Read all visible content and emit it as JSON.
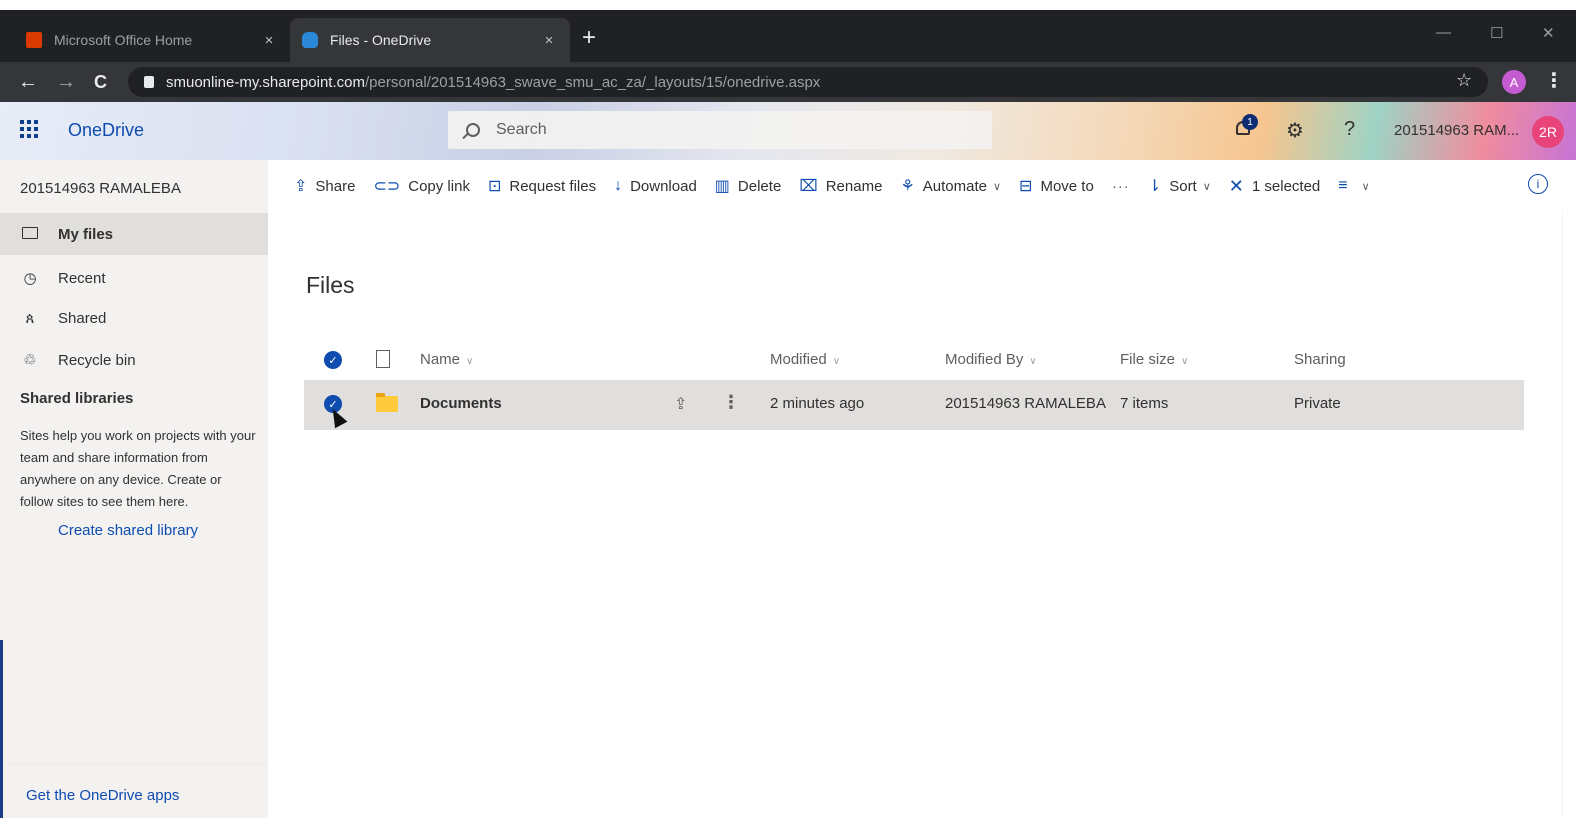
{
  "browser": {
    "tabs": [
      {
        "title": "Microsoft Office Home",
        "close": "×"
      },
      {
        "title": "Files - OneDrive",
        "close": "×"
      }
    ],
    "new_tab": "+",
    "window_controls": {
      "minimize": "—",
      "maximize": "☐",
      "close": "✕"
    },
    "nav": {
      "back": "←",
      "forward": "→",
      "reload": "C"
    },
    "url_host": "smuonline-my.sharepoint.com",
    "url_path": "/personal/201514963_swave_smu_ac_za/_layouts/15/onedrive.aspx",
    "star": "☆",
    "profile_initial": "A",
    "menu": "⋮"
  },
  "suite": {
    "app_name": "OneDrive",
    "search_placeholder": "Search",
    "notification_count": "1",
    "settings_icon": "⚙",
    "help_icon": "?",
    "user_name": "201514963 RAM...",
    "avatar_initials": "2R"
  },
  "sidebar": {
    "owner": "201514963 RAMALEBA",
    "items": [
      {
        "label": "My files",
        "icon": "folder-icon"
      },
      {
        "label": "Recent",
        "icon": "clock-icon"
      },
      {
        "label": "Shared",
        "icon": "people-icon"
      },
      {
        "label": "Recycle bin",
        "icon": "recycle-bin-icon"
      }
    ],
    "shared_libraries_title": "Shared libraries",
    "shared_libraries_desc": "Sites help you work on projects with your team and share information from anywhere on any device. Create or follow sites to see them here.",
    "create_library": "Create shared library",
    "get_apps": "Get the OneDrive apps"
  },
  "commands": {
    "share": "Share",
    "copy_link": "Copy link",
    "request_files": "Request files",
    "download": "Download",
    "delete": "Delete",
    "rename": "Rename",
    "automate": "Automate",
    "move_to": "Move to",
    "more": "···",
    "sort": "Sort",
    "selected": "1 selected",
    "info": "i"
  },
  "main": {
    "title": "Files",
    "columns": {
      "name": "Name",
      "modified": "Modified",
      "modified_by": "Modified By",
      "file_size": "File size",
      "sharing": "Sharing"
    },
    "rows": [
      {
        "name": "Documents",
        "modified": "2 minutes ago",
        "modified_by": "201514963 RAMALEBA",
        "file_size": "7 items",
        "sharing": "Private",
        "selected": true
      }
    ]
  },
  "colors": {
    "accent": "#0f4cb0",
    "nav_bg": "#f3f2f1",
    "selected_bg": "#e1dfdd",
    "folder": "#ffcb3d"
  }
}
